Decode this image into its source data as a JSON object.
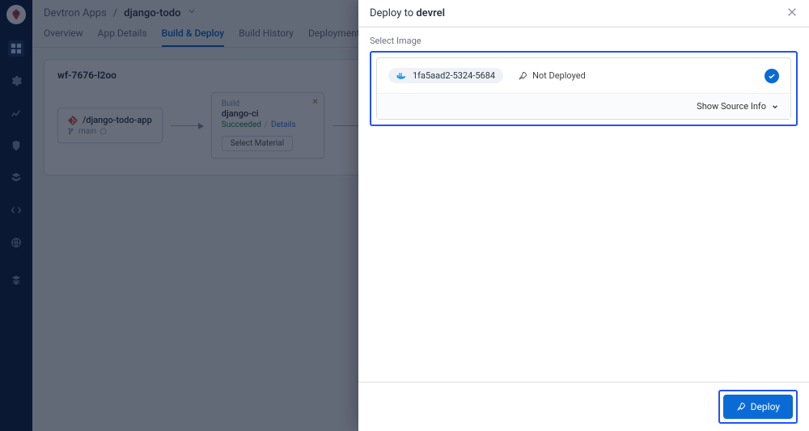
{
  "breadcrumb": {
    "root": "Devtron Apps",
    "sep": "/",
    "app": "django-todo"
  },
  "tabs": {
    "overview": "Overview",
    "app_details": "App Details",
    "build_deploy": "Build & Deploy",
    "build_history": "Build History",
    "deployment_history": "Deployment History",
    "deployment_metrics": "Deployment"
  },
  "workflow": {
    "name": "wf-7676-l2oo",
    "repo": {
      "path": "/django-todo-app",
      "branch": "main"
    },
    "build": {
      "label": "Build",
      "name": "django-ci",
      "status": "Succeeded",
      "sep": "/",
      "details": "Details",
      "select_material": "Select Material"
    }
  },
  "drawer": {
    "title_prefix": "Deploy to ",
    "title_env": "devrel",
    "select_image_label": "Select Image",
    "image": {
      "tag": "1fa5aad2-5324-5684",
      "status": "Not Deployed"
    },
    "show_source": "Show Source Info",
    "deploy_button": "Deploy"
  }
}
